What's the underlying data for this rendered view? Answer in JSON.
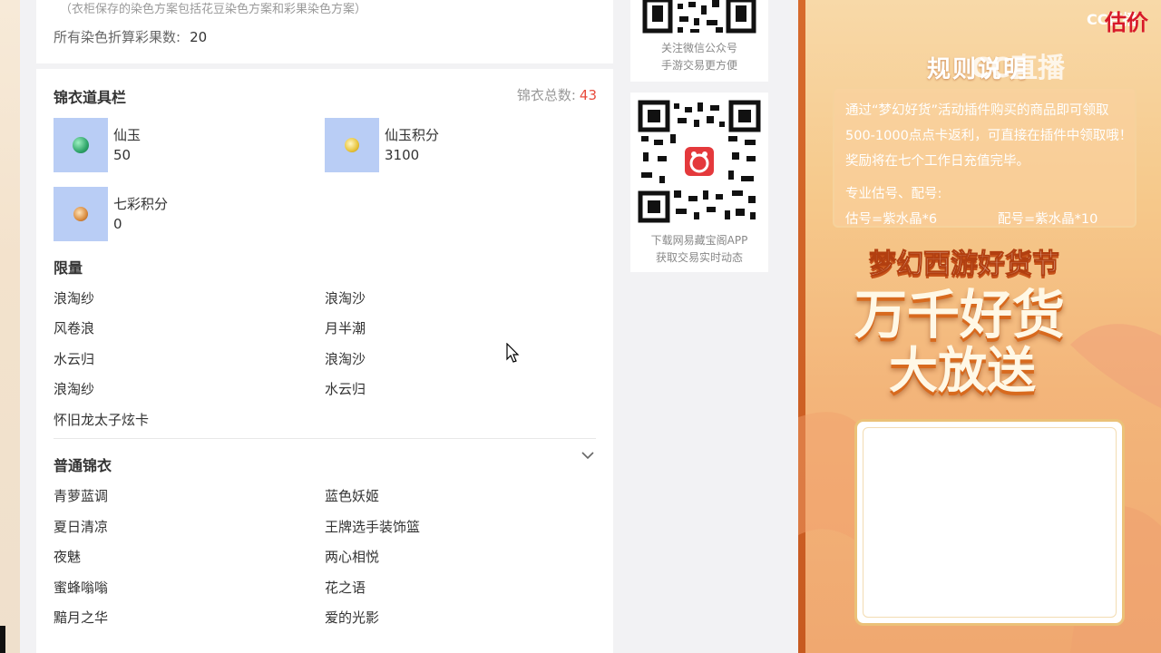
{
  "top_info": {
    "note": "（衣柜保存的染色方案包括花豆染色方案和彩果染色方案）",
    "total_label": "所有染色折算彩果数:",
    "total_value": "20"
  },
  "jinyi": {
    "title": "锦衣道具栏",
    "count_label": "锦衣总数:",
    "count_value": "43",
    "props": [
      {
        "name": "仙玉",
        "value": "50",
        "icon": "jade-gem-icon",
        "color": "#2fa56a"
      },
      {
        "name": "仙玉积分",
        "value": "3100",
        "icon": "jade-points-icon",
        "color": "#e7c33a"
      },
      {
        "name": "七彩积分",
        "value": "0",
        "icon": "rainbow-points-icon",
        "color": "#d98b3e"
      }
    ]
  },
  "limited": {
    "title": "限量",
    "items": [
      "浪淘纱",
      "浪淘沙",
      "风卷浪",
      "月半潮",
      "水云归",
      "浪淘沙",
      "浪淘纱",
      "水云归",
      "怀旧龙太子炫卡"
    ]
  },
  "normal": {
    "title": "普通锦衣",
    "items": [
      "青萝蓝调",
      "蓝色妖姬",
      "夏日清凉",
      "王牌选手装饰篮",
      "夜魅",
      "两心相悦",
      "蜜蜂嗡嗡",
      "花之语",
      "黯月之华",
      "爱的光影"
    ]
  },
  "qr_cards": [
    {
      "line1": "关注微信公众号",
      "line2": "手游交易更方便"
    },
    {
      "line1": "下载网易藏宝阁APP",
      "line2": "获取交易实时动态"
    }
  ],
  "ad": {
    "logo": "CC直播",
    "red_text": "估价",
    "watermark": "CC直播",
    "title": "规则说明",
    "body": "通过“梦幻好货”活动插件购买的商品即可领取500-1000点点卡返利，可直接在插件中领取哦！奖励将在七个工作日充值完毕。",
    "sub_title": "专业估号、配号:",
    "price1": "估号=紫水晶*6",
    "price2": "配号=紫水晶*10",
    "slogan1": "梦幻西游好货节",
    "slogan2": "万千好货",
    "slogan3": "大放送"
  }
}
